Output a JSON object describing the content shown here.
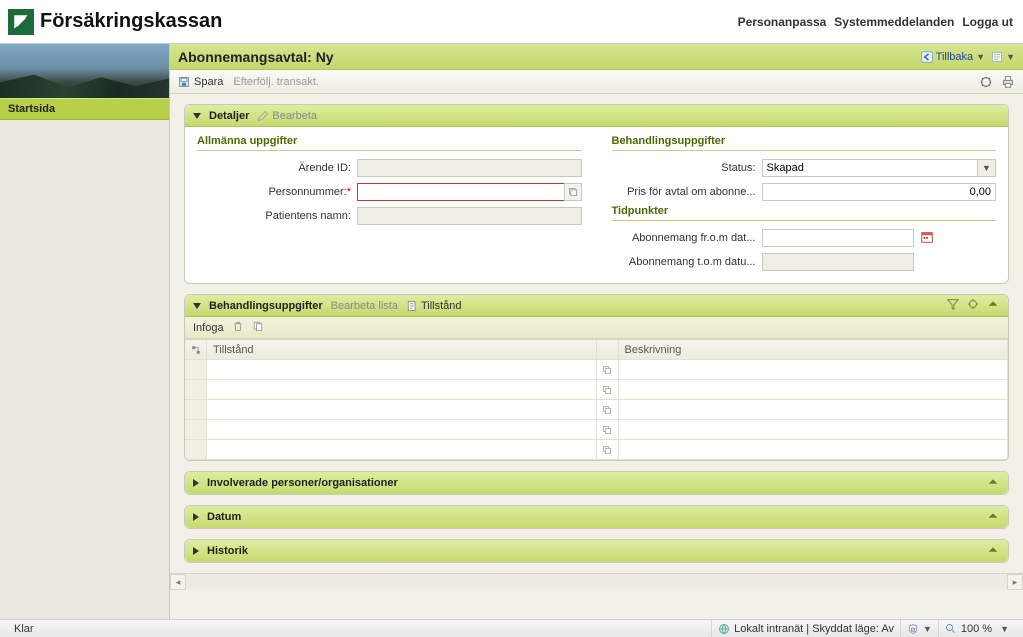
{
  "brand": {
    "title": "Försäkringskassan"
  },
  "top_links": {
    "personalize": "Personanpassa",
    "messages": "Systemmeddelanden",
    "logout": "Logga ut"
  },
  "sidebar": {
    "start": "Startsida"
  },
  "page": {
    "title": "Abonnemangsavtal: Ny"
  },
  "page_actions": {
    "back": "Tillbaka"
  },
  "toolbar": {
    "save": "Spara",
    "followup": "Efterfölj. transakt."
  },
  "panels": {
    "details": {
      "title": "Detaljer",
      "edit": "Bearbeta"
    },
    "treatment": {
      "title": "Behandlingsuppgifter",
      "edit_list": "Bearbeta lista",
      "condition": "Tillstånd"
    },
    "involved": {
      "title": "Involverade personer/organisationer"
    },
    "date": {
      "title": "Datum"
    },
    "history": {
      "title": "Historik"
    }
  },
  "groups": {
    "general": "Allmänna uppgifter",
    "treatment": "Behandlingsuppgifter",
    "timepoints": "Tidpunkter"
  },
  "fields": {
    "arende_id": {
      "label": "Ärende ID:",
      "value": ""
    },
    "personnummer": {
      "label": "Personnummer:",
      "value": ""
    },
    "patientnamn": {
      "label": "Patientens namn:",
      "value": ""
    },
    "status": {
      "label": "Status:",
      "value": "Skapad"
    },
    "price": {
      "label": "Pris för avtal om abonne...",
      "value": "0,00"
    },
    "from_date": {
      "label": "Abonnemang fr.o.m dat...",
      "value": ""
    },
    "to_date": {
      "label": "Abonnemang t.o.m datu...",
      "value": ""
    }
  },
  "grid": {
    "insert": "Infoga",
    "columns": {
      "condition": "Tillstånd",
      "description": "Beskrivning"
    },
    "rows": [
      {
        "condition": "",
        "description": ""
      },
      {
        "condition": "",
        "description": ""
      },
      {
        "condition": "",
        "description": ""
      },
      {
        "condition": "",
        "description": ""
      },
      {
        "condition": "",
        "description": ""
      }
    ]
  },
  "statusbar": {
    "ready": "Klar",
    "intranet": "Lokalt intranät | Skyddat läge: Av",
    "zoom": "100 %"
  }
}
